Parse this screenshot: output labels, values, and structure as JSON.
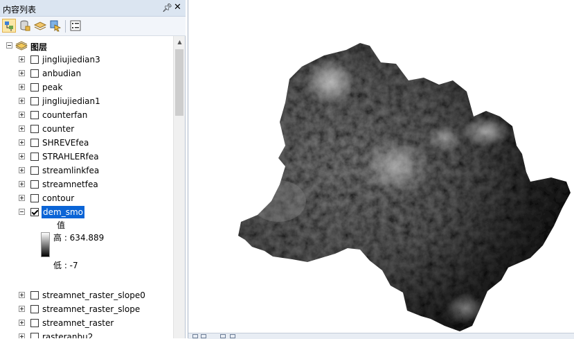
{
  "panel": {
    "title": "内容列表",
    "pin_icon": "pin-icon",
    "close_icon": "close-icon"
  },
  "toolbar": {
    "buttons": [
      {
        "icon": "list-by-drawing-order-icon",
        "active": true
      },
      {
        "icon": "list-by-source-icon"
      },
      {
        "icon": "list-by-visibility-icon"
      },
      {
        "icon": "list-by-selection-icon"
      },
      {
        "icon": "options-icon"
      }
    ]
  },
  "tree": {
    "root_label": "图层",
    "layers": [
      {
        "name": "jingliujiedian3",
        "checked": false,
        "expanded": false
      },
      {
        "name": "anbudian",
        "checked": false,
        "expanded": false
      },
      {
        "name": "peak",
        "checked": false,
        "expanded": false
      },
      {
        "name": "jingliujiedian1",
        "checked": false,
        "expanded": false
      },
      {
        "name": "counterfan",
        "checked": false,
        "expanded": false
      },
      {
        "name": "counter",
        "checked": false,
        "expanded": false
      },
      {
        "name": "SHREVEfea",
        "checked": false,
        "expanded": false
      },
      {
        "name": "STRAHLERfea",
        "checked": false,
        "expanded": false
      },
      {
        "name": "streamlinkfea",
        "checked": false,
        "expanded": false
      },
      {
        "name": "streamnetfea",
        "checked": false,
        "expanded": false
      },
      {
        "name": "contour",
        "checked": false,
        "expanded": false
      },
      {
        "name": "dem_smo",
        "checked": true,
        "expanded": true,
        "selected": true
      },
      {
        "name": "streamnet_raster_slope0",
        "checked": false,
        "expanded": false
      },
      {
        "name": "streamnet_raster_slope",
        "checked": false,
        "expanded": false
      },
      {
        "name": "streamnet_raster",
        "checked": false,
        "expanded": false
      },
      {
        "name": "rasteranbu2",
        "checked": false,
        "expanded": false
      }
    ],
    "legend": {
      "heading": "值",
      "high": "高 : 634.889",
      "low": "低 : -7",
      "ramp_start": "#ffffff",
      "ramp_end": "#000000"
    }
  },
  "map": {
    "background": "#ffffff",
    "raster_layer": "dem_smo"
  }
}
